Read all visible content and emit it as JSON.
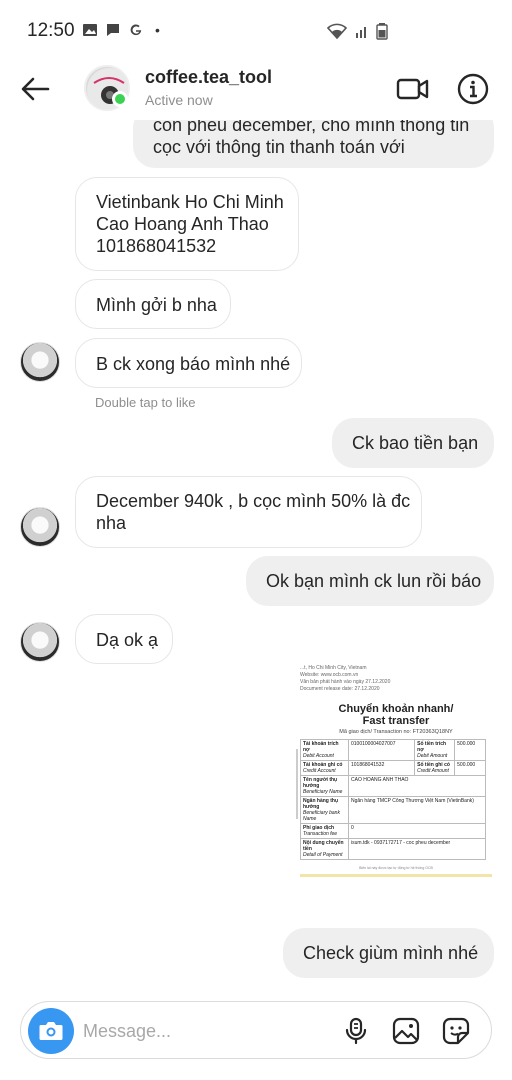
{
  "status_bar": {
    "time": "12:50",
    "dot": "•"
  },
  "header": {
    "contact_name": "coffee.tea_tool",
    "contact_status": "Active now"
  },
  "messages": {
    "m0": {
      "lines": [
        "con phếu december, cho mình thông tin",
        "cọc với thông tin thanh toán với"
      ]
    },
    "m1": {
      "lines": [
        "Vietinbank Ho Chi Minh",
        "Cao Hoang Anh Thao",
        "101868041532"
      ]
    },
    "m2": {
      "lines": [
        "Mình gởi b nha"
      ]
    },
    "m3": {
      "lines": [
        "B ck xong báo mình nhé"
      ]
    },
    "m4": {
      "lines": [
        "Ck bao tiền bạn"
      ]
    },
    "m5": {
      "lines": [
        "December 940k , b cọc mình 50% là đc",
        "nha"
      ]
    },
    "m6": {
      "lines": [
        "Ok bạn mình ck lun rồi báo"
      ]
    },
    "m7": {
      "lines": [
        "Dạ ok ạ"
      ]
    },
    "m8": {
      "lines": [
        "Check giùm mình nhé"
      ]
    }
  },
  "hint": "Double tap to like",
  "receipt": {
    "top_lines": [
      "...t, Ho Chi Minh City, Vietnam",
      "Website: www.ocb.com.vn",
      "Văn bản phát hành vào ngày 27.12.2020",
      "Document release date: 27.12.2020"
    ],
    "title_line1": "Chuyển khoản nhanh/",
    "title_line2": "Fast transfer",
    "transaction": "Mã giao dịch/ Transaction no: FT20363Q18NY",
    "rows": {
      "debit_label": "Tài khoản trích nợ",
      "debit_label_en": "Debit Account",
      "debit_value": "0100100004027007",
      "debit_amount_label": "Số tiền trích nợ",
      "debit_amount_label_en": "Debit Amount",
      "debit_amount": "500.000",
      "credit_label": "Tài khoản ghi có",
      "credit_label_en": "Credit Account",
      "credit_value": "101868041532",
      "credit_amount_label": "Số tiền ghi có",
      "credit_amount_label_en": "Credit Amount",
      "credit_amount": "500.000",
      "beneficiary_label": "Tên người thụ hưởng",
      "beneficiary_label_en": "Beneficiary Name",
      "beneficiary_value": "CAO HOANG ANH THAO",
      "bank_label": "Ngân hàng thụ hưởng",
      "bank_label_en": "Beneficiary bank Name",
      "bank_value": "Ngân hàng TMCP Công Thương Việt Nam (VietinBank)",
      "fee_label": "Phí giao dịch",
      "fee_label_en": "Transaction fee",
      "fee_value": "0",
      "detail_label": "Nội dung chuyển tiền",
      "detail_label_en": "Detail of Payment",
      "detail_value": "isum.tdk - 0937172717 - coc pheu december"
    },
    "footer": "Biên lai này được tạo tự động từ hệ thống OCB"
  },
  "input": {
    "placeholder": "Message..."
  },
  "colors": {
    "accent_blue": "#3897f0",
    "online_green": "#3ad154",
    "bubble_out": "#efefef"
  },
  "icons": {
    "back": "arrow-left-icon",
    "video": "video-camera-icon",
    "info": "info-icon",
    "camera": "camera-icon",
    "mic": "microphone-icon",
    "gallery": "image-icon",
    "sticker": "sticker-icon"
  }
}
